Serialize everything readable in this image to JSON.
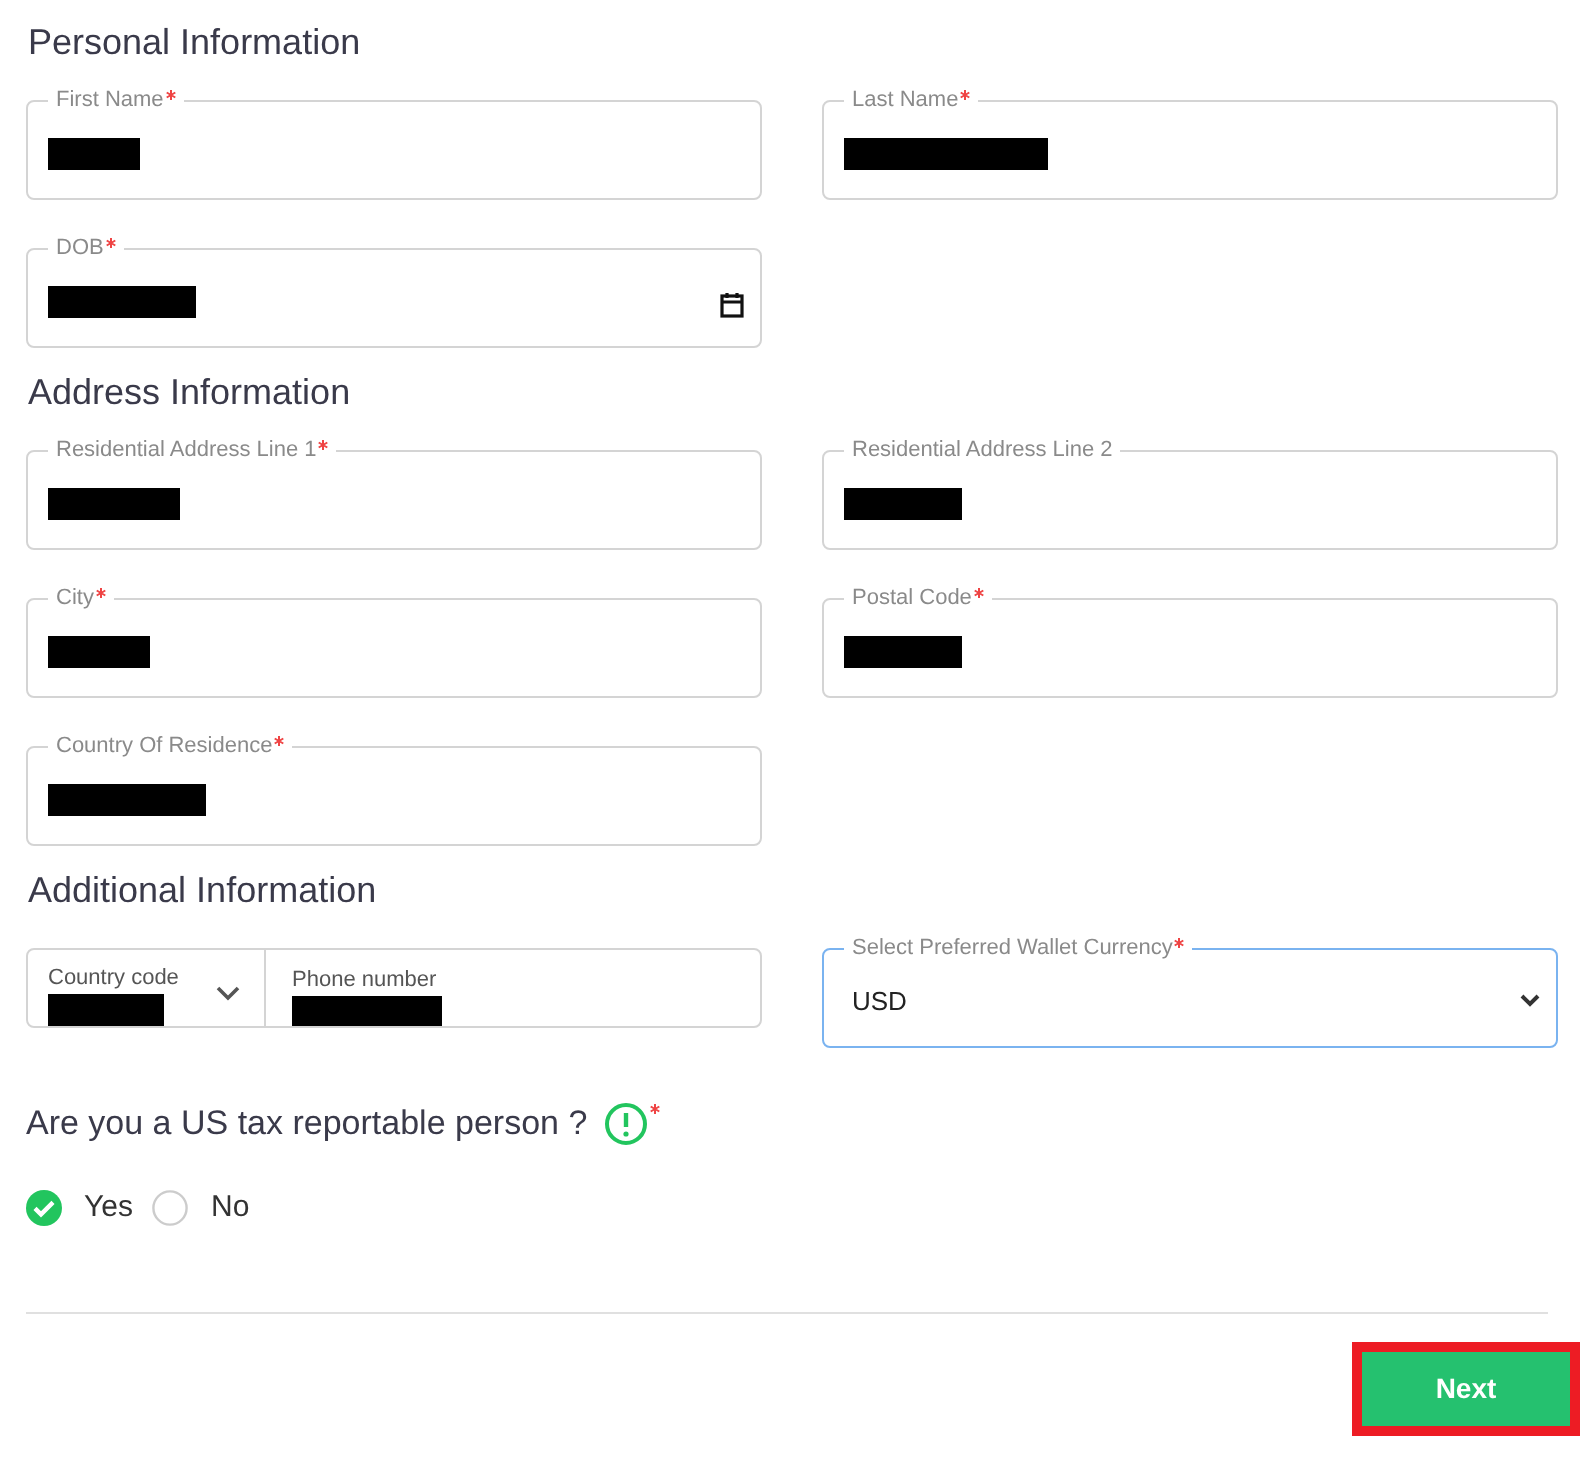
{
  "sections": [
    {
      "title": "Personal Information",
      "rows": [
        [
          {
            "kind": "text",
            "label": "First Name",
            "required": true,
            "redacted": true
          },
          {
            "kind": "text",
            "label": "Last Name",
            "required": true,
            "redacted": true
          }
        ],
        [
          {
            "kind": "date",
            "label": "DOB",
            "required": true,
            "redacted": true
          }
        ]
      ]
    },
    {
      "title": "Address Information",
      "rows": [
        [
          {
            "kind": "text",
            "label": "Residential Address Line 1",
            "required": true,
            "redacted": true
          },
          {
            "kind": "text",
            "label": "Residential Address Line 2",
            "required": false,
            "redacted": true
          }
        ],
        [
          {
            "kind": "text",
            "label": "City",
            "required": true,
            "redacted": true
          },
          {
            "kind": "text",
            "label": "Postal Code",
            "required": true,
            "redacted": true
          }
        ],
        [
          {
            "kind": "text",
            "label": "Country Of Residence",
            "required": true,
            "redacted": true
          }
        ]
      ]
    },
    {
      "title": "Additional Information",
      "rows": [
        [
          {
            "kind": "phone",
            "code_label": "Country code",
            "code_redacted": true,
            "number_label": "Phone number",
            "number_redacted": true
          },
          {
            "kind": "select",
            "label": "Select Preferred Wallet Currency",
            "required": true,
            "value": "USD",
            "focused": true
          }
        ]
      ]
    }
  ],
  "question": {
    "text": "Are you a US tax reportable person ?",
    "required": true,
    "options": [
      {
        "label": "Yes",
        "selected": true
      },
      {
        "label": "No",
        "selected": false
      }
    ]
  },
  "next_button": {
    "label": "Next",
    "highlighted": true
  }
}
